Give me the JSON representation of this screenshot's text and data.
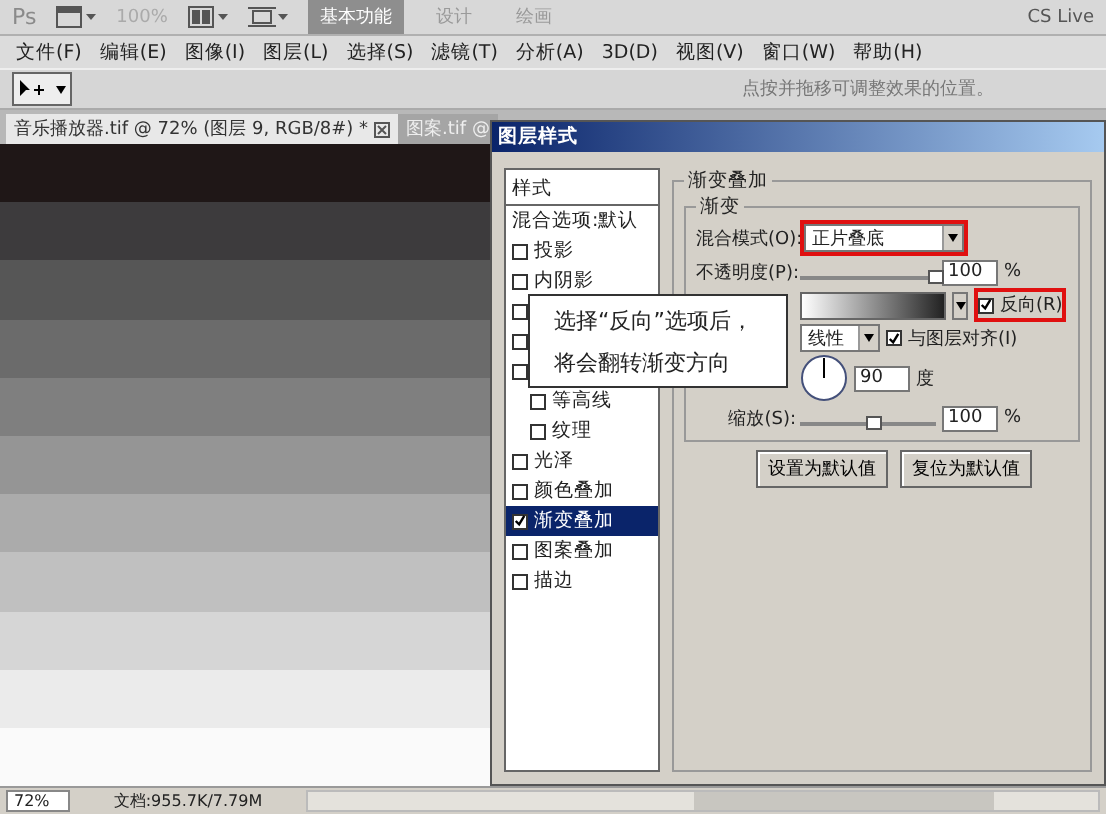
{
  "app_bar": {
    "logo": "Ps",
    "zoom": "100%",
    "workspaces": [
      {
        "label": "基本功能",
        "selected": true
      },
      {
        "label": "设计",
        "selected": false
      },
      {
        "label": "绘画",
        "selected": false
      }
    ],
    "cs_live": "CS Live"
  },
  "menu_bar": [
    "文件(F)",
    "编辑(E)",
    "图像(I)",
    "图层(L)",
    "选择(S)",
    "滤镜(T)",
    "分析(A)",
    "3D(D)",
    "视图(V)",
    "窗口(W)",
    "帮助(H)"
  ],
  "options_bar": {
    "hint": "点按并拖移可调整效果的位置。"
  },
  "document_tabs": [
    {
      "label": "音乐播放器.tif @ 72% (图层 9, RGB/8#) *",
      "selected": true,
      "closable": true
    },
    {
      "label": "图案.tif @",
      "selected": false,
      "closable": false
    }
  ],
  "dialog": {
    "title": "图层样式",
    "styles_header": "样式",
    "items": [
      {
        "kind": "plain",
        "label": "混合选项:默认",
        "selected": false
      },
      {
        "kind": "check",
        "label": "投影",
        "checked": false,
        "selected": false
      },
      {
        "kind": "check",
        "label": "内阴影",
        "checked": false,
        "selected": false
      },
      {
        "kind": "check",
        "checked": false,
        "selected": false
      },
      {
        "kind": "check",
        "checked": false,
        "selected": false
      },
      {
        "kind": "check",
        "checked": false,
        "selected": false,
        "children": [
          {
            "kind": "check",
            "label": "等高线",
            "checked": false,
            "selected": false
          },
          {
            "kind": "check",
            "label": "纹理",
            "checked": false,
            "selected": false
          }
        ]
      },
      {
        "kind": "check",
        "label": "光泽",
        "checked": false,
        "selected": false
      },
      {
        "kind": "check",
        "label": "颜色叠加",
        "checked": false,
        "selected": false
      },
      {
        "kind": "check",
        "label": "渐变叠加",
        "checked": true,
        "selected": true
      },
      {
        "kind": "check",
        "label": "图案叠加",
        "checked": false,
        "selected": false
      },
      {
        "kind": "check",
        "label": "描边",
        "checked": false,
        "selected": false
      }
    ],
    "section_title": "渐变叠加",
    "group_title": "渐变",
    "blend_mode": {
      "label": "混合模式(O):",
      "value": "正片叠底",
      "highlighted": true
    },
    "opacity": {
      "label": "不透明度(P):",
      "level": 1,
      "value": "100",
      "unit": "%"
    },
    "reverse": {
      "label": "反向(R)",
      "checked": true,
      "highlighted": true
    },
    "style": {
      "value": "线性"
    },
    "align": {
      "label": "与图层对齐(I)",
      "checked": true
    },
    "angle": {
      "value": "90",
      "unit": "度"
    },
    "scale": {
      "label": "缩放(S):",
      "level": 0.55,
      "value": "100",
      "unit": "%"
    },
    "buttons": [
      "设置为默认值",
      "复位为默认值"
    ]
  },
  "callout": {
    "lines": [
      "选择“反向”选项后，",
      "将会翻转渐变方向"
    ]
  },
  "status_bar": {
    "zoom": "72%",
    "document_info": "文档:955.7K/7.79M"
  }
}
